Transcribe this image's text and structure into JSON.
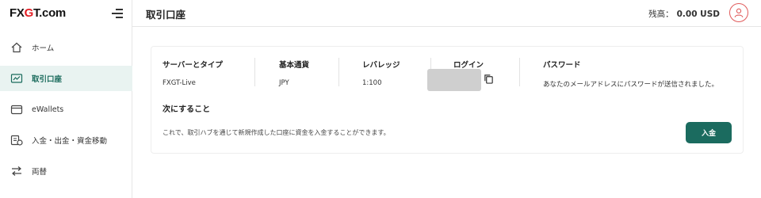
{
  "brand": {
    "logo_prefix": "FX",
    "logo_g": "G",
    "logo_suffix": "T.com"
  },
  "sidebar": {
    "items": [
      {
        "label": "ホーム",
        "icon": "home-icon"
      },
      {
        "label": "取引口座",
        "icon": "trading-account-icon",
        "active": true
      },
      {
        "label": "eWallets",
        "icon": "wallet-icon"
      },
      {
        "label": "入金・出金・資金移動",
        "icon": "money-transfer-icon"
      },
      {
        "label": "両替",
        "icon": "exchange-icon"
      }
    ]
  },
  "header": {
    "title": "取引口座",
    "balance_label": "残高：",
    "balance_value": "0.00 USD"
  },
  "account": {
    "server_label": "サーバーとタイプ",
    "server_value": "FXGT-Live",
    "currency_label": "基本通貨",
    "currency_value": "JPY",
    "leverage_label": "レバレッジ",
    "leverage_value": "1:100",
    "login_label": "ログイン",
    "password_label": "パスワード",
    "password_value": "あなたのメールアドレスにパスワードが送信されました。"
  },
  "next": {
    "title": "次にすること",
    "description": "これで、取引ハブを通じて新規作成した口座に資金を入金することができます。",
    "deposit_label": "入金"
  },
  "colors": {
    "accent": "#1b6b5f",
    "brand_red": "#e31e24",
    "active_bg": "#e9f3f1"
  }
}
